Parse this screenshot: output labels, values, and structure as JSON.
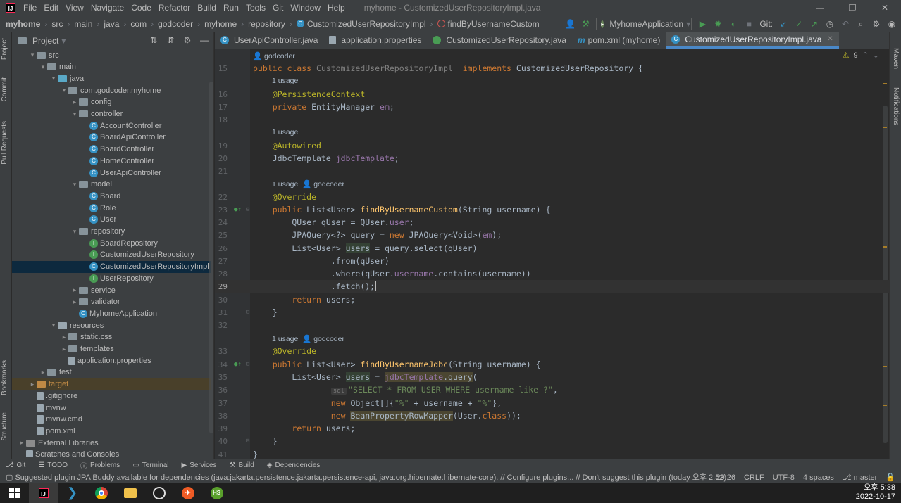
{
  "titlebar": {
    "menus": [
      "File",
      "Edit",
      "View",
      "Navigate",
      "Code",
      "Refactor",
      "Build",
      "Run",
      "Tools",
      "Git",
      "Window",
      "Help"
    ],
    "title": "myhome - CustomizedUserRepositoryImpl.java",
    "logo": "IJ"
  },
  "breadcrumbs": [
    "myhome",
    "src",
    "main",
    "java",
    "com",
    "godcoder",
    "myhome",
    "repository",
    "CustomizedUserRepositoryImpl",
    "findByUsernameCustom"
  ],
  "toolbar": {
    "run_config": "MyhomeApplication",
    "git_label": "Git:"
  },
  "project_panel": {
    "title": "Project"
  },
  "tree": [
    {
      "depth": 1,
      "arrow": "▾",
      "icon": "folder",
      "label": "src"
    },
    {
      "depth": 2,
      "arrow": "▾",
      "icon": "folder",
      "label": "main"
    },
    {
      "depth": 3,
      "arrow": "▾",
      "icon": "folder-src",
      "label": "java"
    },
    {
      "depth": 4,
      "arrow": "▾",
      "icon": "folder",
      "label": "com.godcoder.myhome"
    },
    {
      "depth": 5,
      "arrow": "▸",
      "icon": "folder",
      "label": "config"
    },
    {
      "depth": 5,
      "arrow": "▾",
      "icon": "folder",
      "label": "controller"
    },
    {
      "depth": 6,
      "arrow": "",
      "icon": "class",
      "label": "AccountController"
    },
    {
      "depth": 6,
      "arrow": "",
      "icon": "class",
      "label": "BoardApiController"
    },
    {
      "depth": 6,
      "arrow": "",
      "icon": "class",
      "label": "BoardController"
    },
    {
      "depth": 6,
      "arrow": "",
      "icon": "class",
      "label": "HomeController"
    },
    {
      "depth": 6,
      "arrow": "",
      "icon": "class",
      "label": "UserApiController"
    },
    {
      "depth": 5,
      "arrow": "▾",
      "icon": "folder",
      "label": "model"
    },
    {
      "depth": 6,
      "arrow": "",
      "icon": "class",
      "label": "Board"
    },
    {
      "depth": 6,
      "arrow": "",
      "icon": "class",
      "label": "Role"
    },
    {
      "depth": 6,
      "arrow": "",
      "icon": "class",
      "label": "User"
    },
    {
      "depth": 5,
      "arrow": "▾",
      "icon": "folder",
      "label": "repository"
    },
    {
      "depth": 6,
      "arrow": "",
      "icon": "interface",
      "label": "BoardRepository"
    },
    {
      "depth": 6,
      "arrow": "",
      "icon": "interface",
      "label": "CustomizedUserRepository"
    },
    {
      "depth": 6,
      "arrow": "",
      "icon": "class",
      "label": "CustomizedUserRepositoryImpl",
      "selected": true
    },
    {
      "depth": 6,
      "arrow": "",
      "icon": "interface",
      "label": "UserRepository"
    },
    {
      "depth": 5,
      "arrow": "▸",
      "icon": "folder",
      "label": "service"
    },
    {
      "depth": 5,
      "arrow": "▸",
      "icon": "folder",
      "label": "validator"
    },
    {
      "depth": 5,
      "arrow": "",
      "icon": "class",
      "label": "MyhomeApplication"
    },
    {
      "depth": 3,
      "arrow": "▾",
      "icon": "folder-res",
      "label": "resources"
    },
    {
      "depth": 4,
      "arrow": "▸",
      "icon": "folder",
      "label": "static.css"
    },
    {
      "depth": 4,
      "arrow": "▸",
      "icon": "folder",
      "label": "templates"
    },
    {
      "depth": 4,
      "arrow": "",
      "icon": "file",
      "label": "application.properties"
    },
    {
      "depth": 2,
      "arrow": "▸",
      "icon": "folder",
      "label": "test"
    },
    {
      "depth": 1,
      "arrow": "▸",
      "icon": "folder-orange",
      "label": "target",
      "highlight": true
    },
    {
      "depth": 1,
      "arrow": "",
      "icon": "file",
      "label": ".gitignore"
    },
    {
      "depth": 1,
      "arrow": "",
      "icon": "file",
      "label": "mvnw"
    },
    {
      "depth": 1,
      "arrow": "",
      "icon": "file",
      "label": "mvnw.cmd"
    },
    {
      "depth": 1,
      "arrow": "",
      "icon": "file",
      "label": "pom.xml"
    },
    {
      "depth": 0,
      "arrow": "▸",
      "icon": "library",
      "label": "External Libraries"
    },
    {
      "depth": 0,
      "arrow": "",
      "icon": "file",
      "label": "Scratches and Consoles"
    }
  ],
  "tabs": [
    {
      "label": "UserApiController.java",
      "icon": "C"
    },
    {
      "label": "application.properties",
      "icon": "P"
    },
    {
      "label": "CustomizedUserRepository.java",
      "icon": "I"
    },
    {
      "label": "pom.xml (myhome)",
      "icon": "m"
    },
    {
      "label": "CustomizedUserRepositoryImpl.java",
      "icon": "C",
      "active": true
    }
  ],
  "editor": {
    "warnings": "9"
  },
  "side_tabs": {
    "left": [
      "Project",
      "Commit",
      "Pull Requests",
      "Bookmarks",
      "Structure"
    ],
    "right": [
      "Maven",
      "Notifications"
    ]
  },
  "bottom_tools": [
    "Git",
    "TODO",
    "Problems",
    "Terminal",
    "Services",
    "Build",
    "Dependencies"
  ],
  "status": {
    "message": "Suggested plugin JPA Buddy available for dependencies (java:jakarta.persistence:jakarta.persistence-api, java:org.hibernate:hibernate-core). // Configure plugins... // Don't suggest this plugin (today 오후 2:52)",
    "position": "29:26",
    "line_sep": "CRLF",
    "encoding": "UTF-8",
    "indent": "4 spaces",
    "branch": "master"
  },
  "taskbar": {
    "time": "오후 5:38",
    "date": "2022-10-17",
    "hs_label": "HS"
  }
}
